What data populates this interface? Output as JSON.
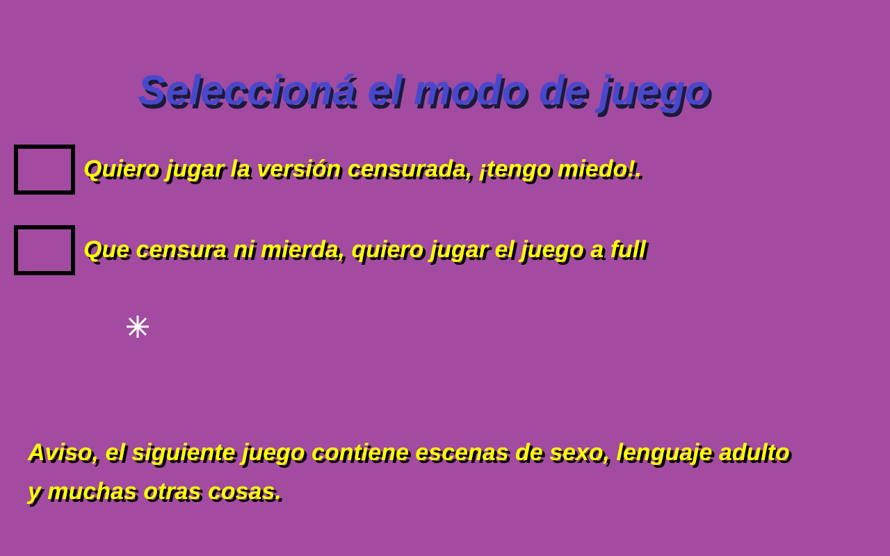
{
  "title": "Seleccioná el modo de juego",
  "options": [
    {
      "label": "Quiero jugar la versión censurada, ¡tengo miedo!.",
      "checked": false
    },
    {
      "label": "Que censura ni mierda, quiero jugar el juego a full",
      "checked": false
    }
  ],
  "warning": "Aviso, el siguiente juego contiene escenas de sexo, lenguaje adulto y muchas otras cosas."
}
